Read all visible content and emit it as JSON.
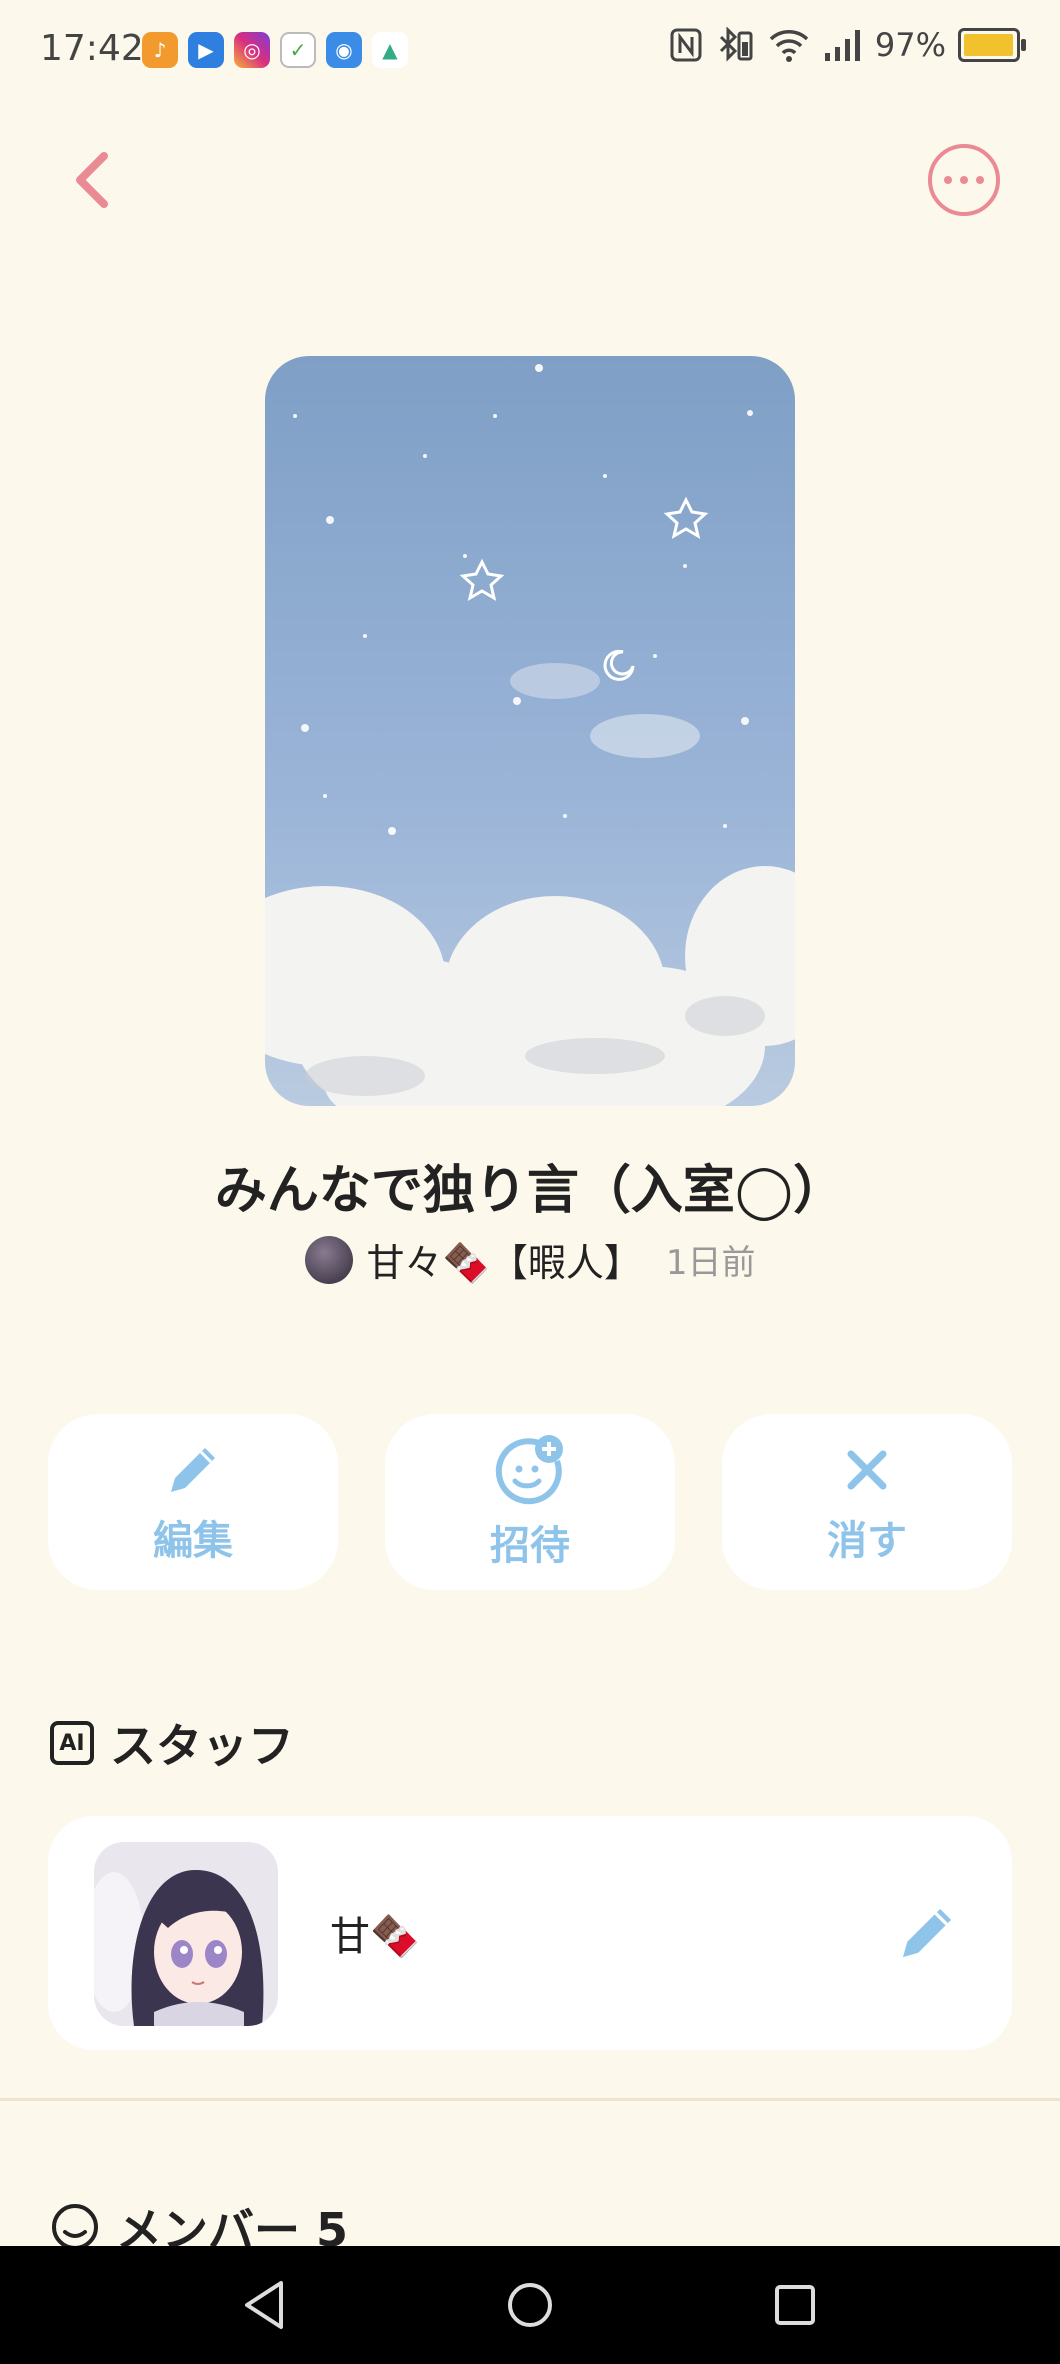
{
  "status_bar": {
    "time": "17:42",
    "battery": "97%",
    "battery_level": 0.97,
    "app_icons": [
      "music-icon",
      "youtube-icon",
      "instagram-icon",
      "clock-icon",
      "chrome-icon",
      "maps-icon"
    ]
  },
  "header": {
    "back_icon": "chevron-left-icon",
    "more_icon": "more-horizontal-icon",
    "accent_color": "#e98a95"
  },
  "room": {
    "title": "みんなで独り言（入室◯）",
    "owner_name": "甘々🍫【暇人】",
    "posted_ago": "1日前"
  },
  "actions": [
    {
      "label": "編集",
      "icon": "pencil-icon"
    },
    {
      "label": "招待",
      "icon": "add-person-icon"
    },
    {
      "label": "消す",
      "icon": "close-icon"
    }
  ],
  "action_color": "#8fc4ea",
  "staff": {
    "badge": "AI",
    "title": "スタッフ",
    "members": [
      {
        "name": "甘🍫",
        "edit_icon": "pencil-icon"
      }
    ]
  },
  "members": {
    "title": "メンバー 5"
  },
  "nav_bar": {
    "buttons": [
      "back-triangle-icon",
      "home-circle-icon",
      "recents-square-icon"
    ]
  }
}
